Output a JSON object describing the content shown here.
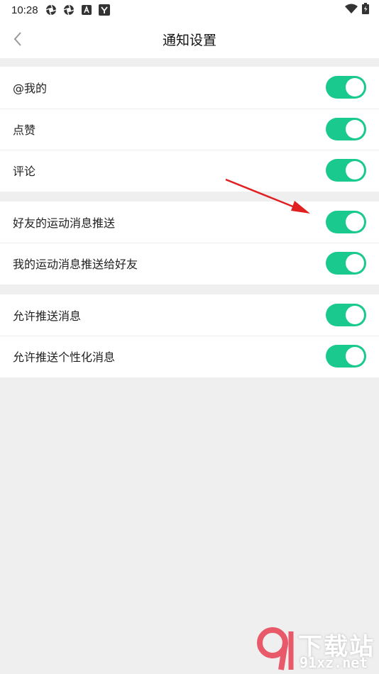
{
  "statusbar": {
    "time": "10:28",
    "icons": [
      "aperture-icon",
      "aperture-icon",
      "app-icon",
      "app-icon"
    ],
    "right_icons": [
      "wifi-icon",
      "battery-icon"
    ]
  },
  "header": {
    "title": "通知设置",
    "back_icon": "chevron-left-icon"
  },
  "groups": [
    {
      "items": [
        {
          "label": "@我的",
          "on": true
        },
        {
          "label": "点赞",
          "on": true
        },
        {
          "label": "评论",
          "on": true
        }
      ]
    },
    {
      "items": [
        {
          "label": "好友的运动消息推送",
          "on": true
        },
        {
          "label": "我的运动消息推送给好友",
          "on": true
        }
      ]
    },
    {
      "items": [
        {
          "label": "允许推送消息",
          "on": true
        },
        {
          "label": "允许推送个性化消息",
          "on": true
        }
      ]
    }
  ],
  "watermark": {
    "brand": "下载站",
    "url": "91xz.net"
  },
  "colors": {
    "toggle_on": "#19c98e",
    "background": "#efefef",
    "arrow": "#e02020"
  }
}
